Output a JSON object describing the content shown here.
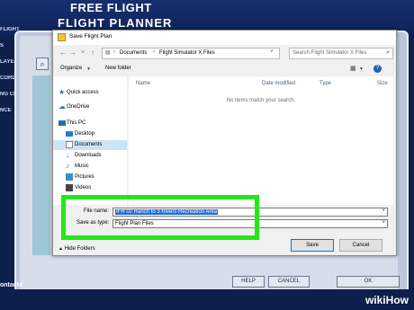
{
  "background_app": {
    "header_small": "FREE FLIGHT",
    "header_title": "FLIGHT PLANNER",
    "side_menu": [
      "FLIGHT",
      "S",
      "LAYER",
      "CORDS",
      "NG CR",
      "NCE"
    ],
    "zoom_icon": "magnifier-icon",
    "bottom_left_label": "ontacts",
    "buttons": [
      "HELP",
      "CANCEL",
      "OK"
    ],
    "watermark_wiki": "wiki",
    "watermark_how": "How"
  },
  "dialog": {
    "title": "Save Flight Plan",
    "address": {
      "crumbs": [
        "Documents",
        "Flight Simulator X Files"
      ]
    },
    "search_placeholder": "Search Flight Simulator X Files",
    "toolbar": {
      "organize": "Organize",
      "new_folder": "New folder"
    },
    "nav": {
      "items": [
        {
          "label": "Quick access",
          "icon": "star-icon",
          "color": "#1e73d2"
        },
        {
          "label": "OneDrive",
          "icon": "cloud-icon",
          "color": "#1e73d2"
        },
        {
          "label": "This PC",
          "icon": "computer-icon",
          "color": "#2b6ea8"
        },
        {
          "label": "Desktop",
          "icon": "desktop-icon",
          "color": "#2b7bd6"
        },
        {
          "label": "Documents",
          "icon": "documents-icon",
          "color": "#8a8a8a",
          "selected": true
        },
        {
          "label": "Downloads",
          "icon": "download-icon",
          "color": "#1e73d2"
        },
        {
          "label": "Music",
          "icon": "music-icon",
          "color": "#1e73d2"
        },
        {
          "label": "Pictures",
          "icon": "pictures-icon",
          "color": "#3a8fd0"
        },
        {
          "label": "Videos",
          "icon": "videos-icon",
          "color": "#444444"
        }
      ]
    },
    "columns": [
      "Name",
      "Date modified",
      "Type",
      "Size"
    ],
    "empty_message": "No items match your search.",
    "file_name_label": "File name:",
    "file_name_value": "IFR 02 Ranch to 3 Rivers Recreation Area",
    "save_as_type_label": "Save as type:",
    "save_as_type_value": "Flight Plan Files",
    "hide_folders": "Hide Folders",
    "save_button": "Save",
    "cancel_button": "Cancel"
  },
  "colors": {
    "highlight_box": "#22e81a",
    "selection": "#1f6fd1",
    "background_navy": "#0d1f4a"
  }
}
